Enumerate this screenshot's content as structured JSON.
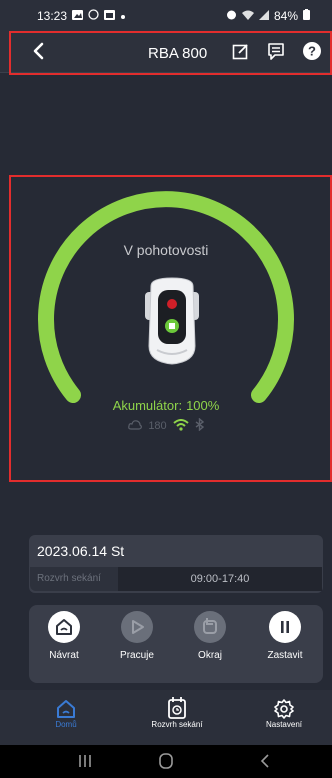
{
  "status_bar": {
    "time": "13:23",
    "battery": "84%"
  },
  "header": {
    "title": "RBA 800"
  },
  "mower": {
    "state": "V pohotovosti",
    "battery_label": "Akumulátor",
    "battery_sep": ":",
    "battery_value": "100%",
    "signal_value": "180"
  },
  "schedule": {
    "date": "2023.06.14 St",
    "label": "Rozvrh sekání",
    "time": "09:00-17:40"
  },
  "actions": [
    {
      "label": "Návrat"
    },
    {
      "label": "Pracuje"
    },
    {
      "label": "Okraj"
    },
    {
      "label": "Zastavit"
    }
  ],
  "tabs": [
    {
      "label": "Domů"
    },
    {
      "label": "Rozvrh sekání"
    },
    {
      "label": "Nastavení"
    }
  ],
  "colors": {
    "accent": "#8fd44a",
    "tab_active": "#3a7bd5",
    "background": "#262a35"
  }
}
